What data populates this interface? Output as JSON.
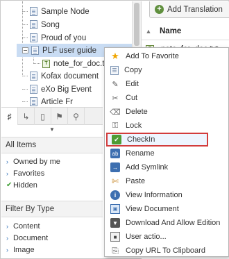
{
  "tree": {
    "nodes": [
      {
        "label": "Sample Node",
        "icon": "document-icon"
      },
      {
        "label": "Song",
        "icon": "document-icon"
      },
      {
        "label": "Proud of you",
        "icon": "document-icon"
      },
      {
        "label": "PLF user guide",
        "icon": "document-icon",
        "selected": true
      },
      {
        "label": "note_for_doc.txt",
        "icon": "txt-file-icon"
      },
      {
        "label": "Kofax document",
        "icon": "document-icon"
      },
      {
        "label": "eXo Big Event",
        "icon": "document-icon"
      },
      {
        "label": "Article Fr",
        "icon": "document-icon"
      }
    ]
  },
  "tabs": [
    {
      "icon": "sitemap-icon"
    },
    {
      "icon": "relation-icon"
    },
    {
      "icon": "clipboard-icon"
    },
    {
      "icon": "tag-icon"
    },
    {
      "icon": "search-icon"
    }
  ],
  "all_items": {
    "title": "All Items",
    "items": [
      {
        "label": "Owned by me",
        "marker": "bullet"
      },
      {
        "label": "Favorites",
        "marker": "bullet"
      },
      {
        "label": "Hidden",
        "marker": "check"
      }
    ]
  },
  "filter_by_type": {
    "title": "Filter By Type",
    "items": [
      {
        "label": "Content"
      },
      {
        "label": "Document"
      },
      {
        "label": "Image"
      }
    ]
  },
  "right_panel": {
    "add_translation_label": "Add Translation",
    "column_name": "Name",
    "row_name": "note_for_doc.txt"
  },
  "context_menu": {
    "items": [
      {
        "label": "Add To Favorite",
        "icon": "star-icon"
      },
      {
        "label": "Copy",
        "icon": "copy-icon"
      },
      {
        "label": "Edit",
        "icon": "edit-icon"
      },
      {
        "label": "Cut",
        "icon": "scissors-icon"
      },
      {
        "label": "Delete",
        "icon": "trash-icon"
      },
      {
        "label": "Lock",
        "icon": "lock-icon"
      },
      {
        "label": "CheckIn",
        "icon": "checkin-icon",
        "highlighted": true
      },
      {
        "label": "Rename",
        "icon": "rename-icon"
      },
      {
        "label": "Add Symlink",
        "icon": "symlink-icon"
      },
      {
        "label": "Paste",
        "icon": "paste-icon"
      },
      {
        "label": "View Information",
        "icon": "info-icon"
      },
      {
        "label": "View Document",
        "icon": "view-document-icon"
      },
      {
        "label": "Download And Allow Edition",
        "icon": "download-icon"
      },
      {
        "label": "User actio...",
        "icon": "user-action-icon"
      },
      {
        "label": "Copy URL To Clipboard",
        "icon": "clipboard-url-icon"
      }
    ]
  },
  "colors": {
    "selected_node_bg": "#c9dcf3",
    "highlight_border": "#d23c3c",
    "accent_blue": "#2a6db7",
    "check_green": "#3a9b2f"
  }
}
